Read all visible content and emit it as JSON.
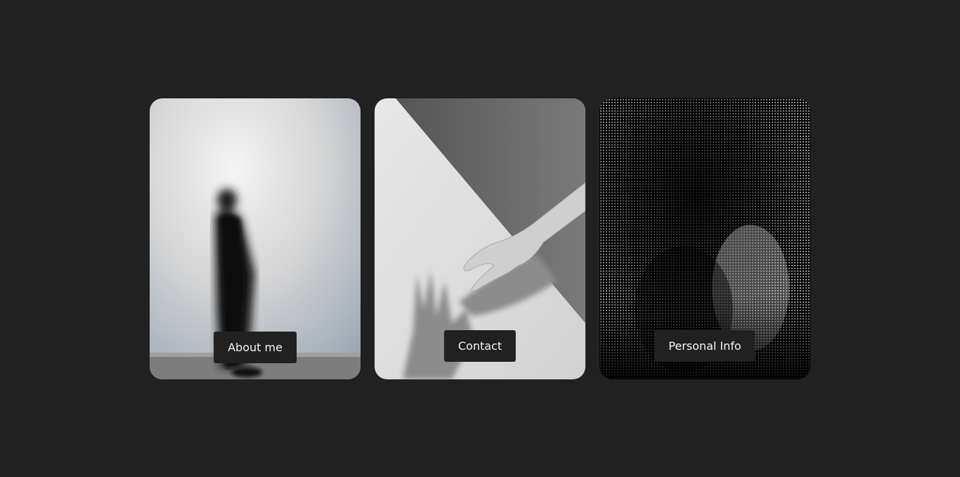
{
  "cards": [
    {
      "label": "About me",
      "image": "blurred-walking-figure-photo"
    },
    {
      "label": "Contact",
      "image": "hand-shadow-on-wall-photo"
    },
    {
      "label": "Personal Info",
      "image": "halftone-portrait-photo"
    }
  ],
  "colors": {
    "background": "#212121",
    "button_bg": "#212121",
    "button_text": "#f4f4f4"
  }
}
